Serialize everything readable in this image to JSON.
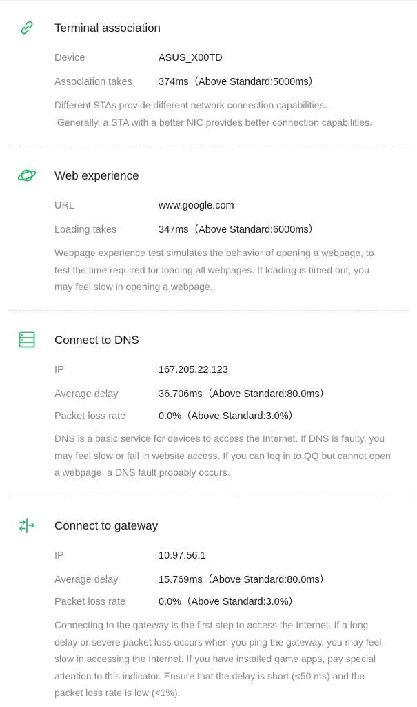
{
  "theme": {
    "accent": "#2fb96e"
  },
  "sections": [
    {
      "title": "Terminal association",
      "icon": "link-icon",
      "rows": [
        {
          "label": "Device",
          "value": "ASUS_X00TD"
        },
        {
          "label": "Association takes",
          "value": "374ms（Above Standard:5000ms）"
        }
      ],
      "desc_lines": [
        "Different STAs provide different network connection capabilities.",
        " Generally, a STA with a better NIC provides better connection capabilities."
      ]
    },
    {
      "title": "Web experience",
      "icon": "planet-icon",
      "rows": [
        {
          "label": "URL",
          "value": "www.google.com"
        },
        {
          "label": "Loading takes",
          "value": "347ms（Above Standard:6000ms）"
        }
      ],
      "desc_lines": [
        "Webpage experience test simulates the behavior of opening a webpage, to",
        "test the time required for loading all webpages. If loading is timed out, you",
        "may feel slow in opening a webpage."
      ]
    },
    {
      "title": "Connect to DNS",
      "icon": "server-icon",
      "rows": [
        {
          "label": "IP",
          "value": "167.205.22.123"
        },
        {
          "label": "Average delay",
          "value": "36.706ms（Above Standard:80.0ms）"
        },
        {
          "label": "Packet loss rate",
          "value": "0.0%（Above Standard:3.0%）"
        }
      ],
      "desc_lines": [
        "DNS is a basic service for devices to access the Internet. If DNS is faulty, you",
        "may feel slow or fail in website access. If you can log in to QQ but cannot open",
        "a webpage, a DNS fault probably occurs."
      ]
    },
    {
      "title": "Connect to gateway",
      "icon": "gateway-arrows-icon",
      "rows": [
        {
          "label": "IP",
          "value": "10.97.56.1"
        },
        {
          "label": "Average delay",
          "value": "15.769ms（Above Standard:80.0ms）"
        },
        {
          "label": "Packet loss rate",
          "value": "0.0%（Above Standard:3.0%）"
        }
      ],
      "desc_lines": [
        "Connecting to the gateway is the first step to access the Internet. If a long",
        "delay or severe packet loss occurs when you ping the gateway, you may feel",
        "slow in accessing the Internet. If you have installed game apps, pay special",
        "attention to this indicator. Ensure that the delay is short (<50 ms) and the",
        "packet loss rate is low (<1%)."
      ]
    }
  ]
}
